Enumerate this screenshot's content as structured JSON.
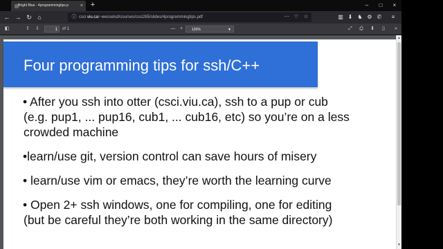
{
  "browser": {
    "tab_title": "Bright Blue - 4programmingtips.p",
    "tab_close": "×",
    "new_tab": "+",
    "window_controls": [
      "–",
      "□",
      "×"
    ],
    "nav": {
      "back": "←",
      "forward": "→",
      "reload": "↻",
      "home": "⌂"
    },
    "url_prefix": "csci.",
    "url_host": "viu.ca",
    "url_path": "/~wesselsd/courses/csci265/slides/4programmingtips.pdf",
    "url_actions": [
      "⋯",
      "♡",
      "☆"
    ],
    "toolbar_icons": [
      "▥",
      "⬇",
      "♞",
      "⚙",
      "✆",
      "≡"
    ]
  },
  "pdf_toolbar": {
    "sidebar_toggle": "◧",
    "prev_page": "⇧",
    "next_page": "⇩",
    "page_number": "1",
    "page_count": "of 1",
    "zoom_out": "—",
    "zoom_in": "+",
    "zoom_value": "120%",
    "right_icons": [
      "⤢",
      "⎙",
      "⬇",
      "▯",
      "»"
    ]
  },
  "slide": {
    "title": "Four programming tips for ssh/C++",
    "bullets": [
      "• After you ssh into otter (csci.viu.ca), ssh to a pup or cub",
      "(e.g. pup1, ... pup16, cub1, ... cub16, etc) so you’re on a less",
      "crowded machine",
      "•learn/use git, version control can save hours of misery",
      "• learn/use vim or emacs, they’re worth the learning curve",
      "• Open 2+ ssh windows, one for compiling, one for editing",
      "(but be careful they’re both working in the same directory)"
    ]
  },
  "scrollbar": {
    "up": "▲",
    "down": "▼"
  },
  "colors": {
    "title_bar": "#2f6fd8",
    "chrome_dark": "#0c0c0d",
    "pdf_toolbar": "#38383d"
  }
}
